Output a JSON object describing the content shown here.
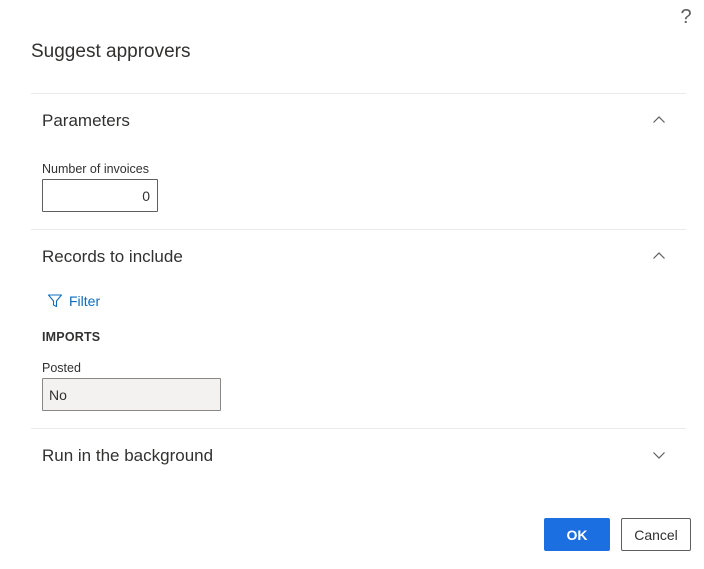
{
  "dialog": {
    "title": "Suggest approvers",
    "help_glyph": "?"
  },
  "sections": {
    "parameters": {
      "title": "Parameters",
      "state": "expanded",
      "fields": {
        "number_of_invoices": {
          "label": "Number of invoices",
          "value": "0"
        }
      }
    },
    "records": {
      "title": "Records to include",
      "state": "expanded",
      "filter_label": "Filter",
      "group_label": "IMPORTS",
      "fields": {
        "posted": {
          "label": "Posted",
          "value": "No"
        }
      }
    },
    "background": {
      "title": "Run in the background",
      "state": "collapsed"
    }
  },
  "footer": {
    "ok_label": "OK",
    "cancel_label": "Cancel"
  },
  "colors": {
    "primary": "#1c6fe0",
    "link": "#0f6cbd",
    "text": "#323130",
    "readonly_bg": "#f3f2f1"
  }
}
